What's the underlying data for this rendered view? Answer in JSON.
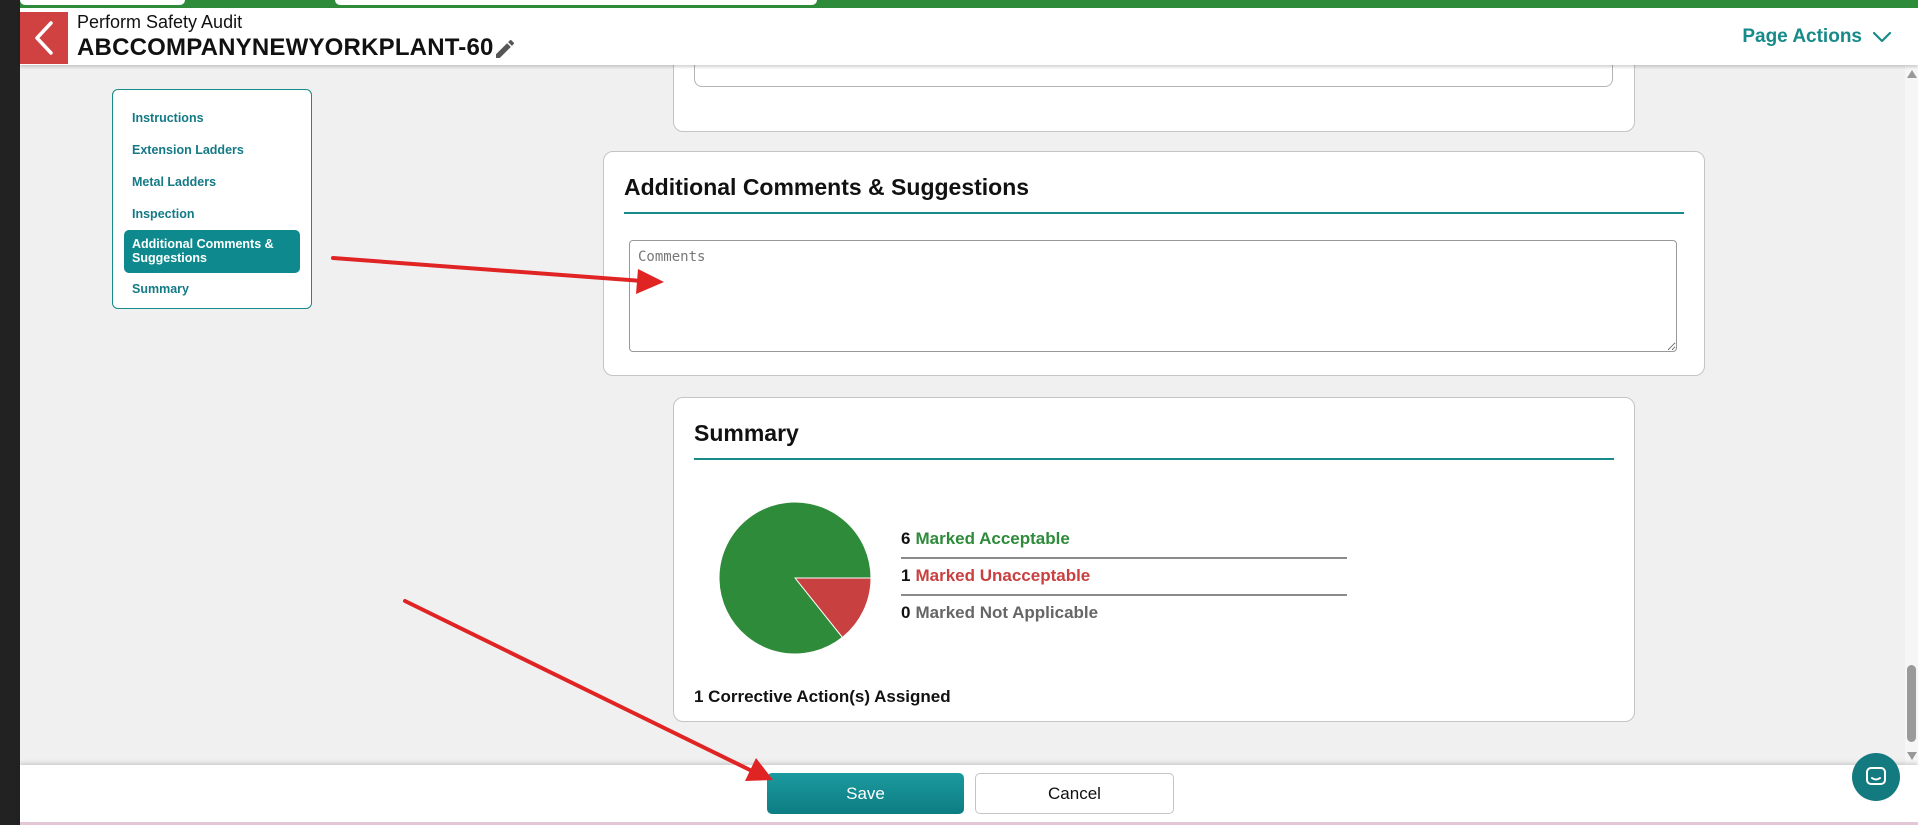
{
  "header": {
    "subtitle": "Perform Safety Audit",
    "title": "ABCCOMPANYNEWYORKPLANT-60",
    "page_actions_label": "Page Actions"
  },
  "toc": {
    "items": [
      {
        "label": "Instructions"
      },
      {
        "label": "Extension Ladders"
      },
      {
        "label": "Metal Ladders"
      },
      {
        "label": "Inspection"
      },
      {
        "label": "Additional Comments & Suggestions",
        "active": true
      },
      {
        "label": "Summary"
      }
    ]
  },
  "comments_section": {
    "title": "Additional Comments & Suggestions",
    "input_value": "",
    "input_placeholder": "Comments"
  },
  "summary_section": {
    "title": "Summary",
    "stats": [
      {
        "count": "6",
        "label": "Marked Acceptable",
        "color": "#2e8b3a"
      },
      {
        "count": "1",
        "label": "Marked Unacceptable",
        "color": "#c94040"
      },
      {
        "count": "0",
        "label": "Marked Not Applicable",
        "color": "#666666"
      }
    ],
    "corrective_actions": "1 Corrective Action(s) Assigned",
    "pie": {
      "acceptable": 6,
      "unacceptable": 1,
      "not_applicable": 0
    }
  },
  "footer": {
    "save_label": "Save",
    "cancel_label": "Cancel"
  },
  "colors": {
    "accent": "#178a8a",
    "back_button": "#d04141",
    "acceptable": "#2e8b3a",
    "unacceptable": "#c94040",
    "annotation_arrow": "#e02424"
  },
  "icons": {
    "back": "chevron-left-icon",
    "edit": "pencil-icon",
    "page_actions": "chevron-down-icon",
    "chat": "chat-bubble-icon"
  }
}
